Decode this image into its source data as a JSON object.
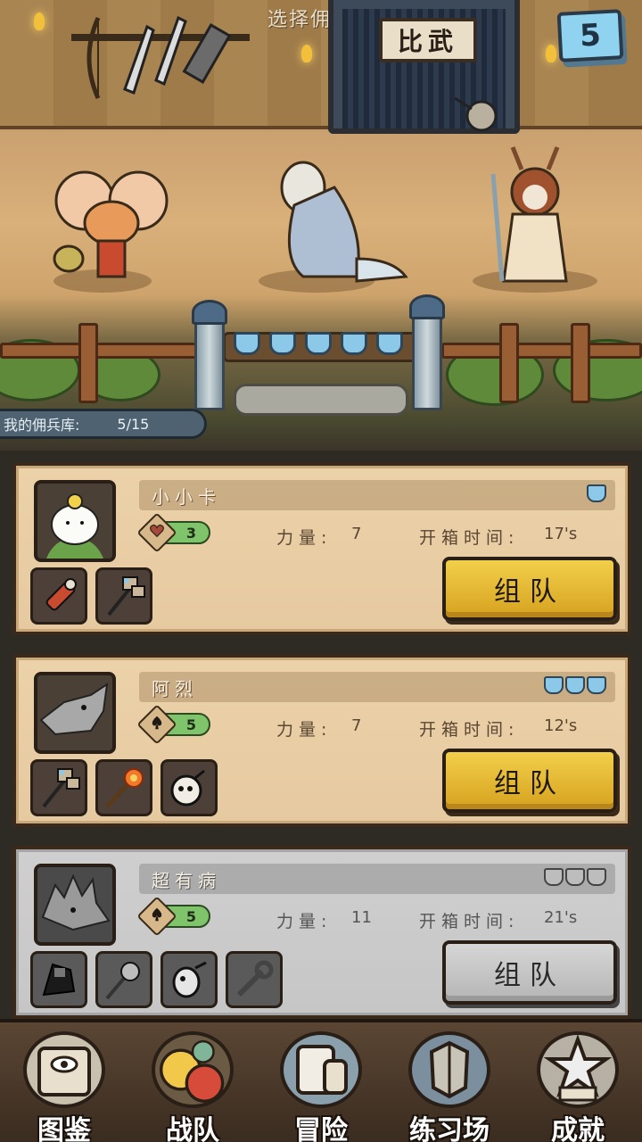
{
  "header": {
    "title": "选择佣兵",
    "gate_sign": "比武",
    "count": "5"
  },
  "roster": {
    "label": "我的佣兵库:",
    "count": "5/15"
  },
  "stat_labels": {
    "power": "力量:",
    "box_time": "开箱时间:"
  },
  "mercenaries": [
    {
      "name": "小小卡",
      "level": "3",
      "level_icon": "heart-icon",
      "power": "7",
      "box_time": "17's",
      "tiers": 1,
      "button": "组队",
      "enabled": true,
      "items": [
        "dynamite-icon",
        "double-hammer-icon"
      ]
    },
    {
      "name": "阿烈",
      "level": "5",
      "level_icon": "spade-icon",
      "power": "7",
      "box_time": "12's",
      "tiers": 3,
      "button": "组队",
      "enabled": true,
      "items": [
        "double-hammer-icon",
        "torch-icon",
        "bomb-icon"
      ]
    },
    {
      "name": "超有病",
      "level": "5",
      "level_icon": "spade-icon",
      "power": "11",
      "box_time": "21's",
      "tiers": 3,
      "button": "组队",
      "enabled": false,
      "items": [
        "shadow-icon",
        "mace-icon",
        "bomb-critter-icon",
        "wrench-icon"
      ]
    }
  ],
  "nav": [
    {
      "label": "图鉴",
      "icon": "book-eye-icon"
    },
    {
      "label": "战队",
      "icon": "skull-team-icon"
    },
    {
      "label": "冒险",
      "icon": "scroll-hand-icon"
    },
    {
      "label": "练习场",
      "icon": "armor-icon"
    },
    {
      "label": "成就",
      "icon": "star-trophy-icon"
    }
  ],
  "colors": {
    "gold_button": "#f2cf4a",
    "card_bg": "#ecd2a9",
    "disabled_card": "#cfcfcf",
    "level_pill": "#7fc36b",
    "tier_shield": "#8cc9e8"
  }
}
